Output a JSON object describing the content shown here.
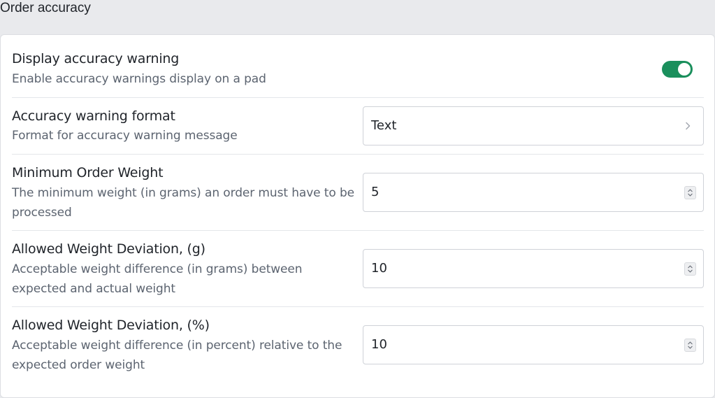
{
  "section": {
    "title": "Order accuracy"
  },
  "settings": [
    {
      "label": "Display accuracy warning",
      "description": "Enable accuracy warnings display on a pad",
      "control": "toggle",
      "enabled": true
    },
    {
      "label": "Accuracy warning format",
      "description": "Format for accuracy warning message",
      "control": "select",
      "value": "Text"
    },
    {
      "label": "Minimum Order Weight",
      "description_lines": [
        "The minimum weight (in grams) an order must have to be",
        "processed"
      ],
      "control": "number",
      "value": "5"
    },
    {
      "label": "Allowed Weight Deviation, (g)",
      "description_lines": [
        "Acceptable weight difference (in grams) between",
        "expected and actual weight"
      ],
      "control": "number",
      "value": "10"
    },
    {
      "label": "Allowed Weight Deviation, (%)",
      "description_lines": [
        "Acceptable weight difference (in percent) relative to the",
        "expected order weight"
      ],
      "control": "number",
      "value": "10"
    }
  ],
  "colors": {
    "toggle_on": "#1a8f5c",
    "background": "#e9eaed"
  },
  "icons": {
    "select_arrow": "chevron-right-icon",
    "number_spinner": "spinner-arrows-icon"
  }
}
